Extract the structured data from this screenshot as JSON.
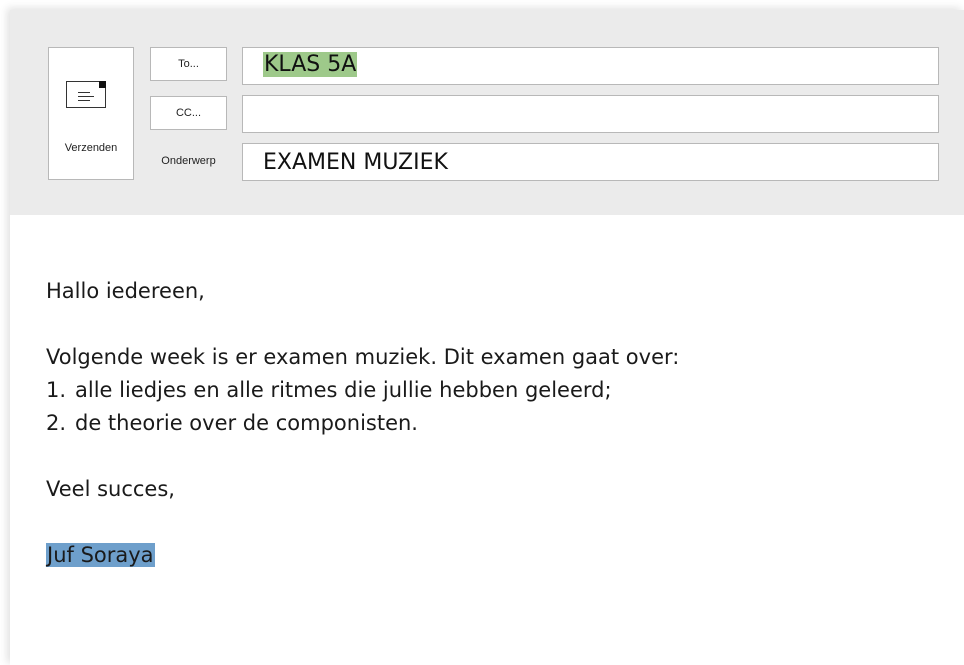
{
  "compose": {
    "send_label": "Verzenden",
    "to_button": "To...",
    "cc_button": "CC...",
    "subject_label": "Onderwerp",
    "to_value": "KLAS 5A",
    "cc_value": "",
    "subject_value": "EXAMEN MUZIEK",
    "highlight_colors": {
      "to_value": "#9ec98a",
      "signature": "#6e9fcb"
    }
  },
  "message": {
    "greeting": "Hallo iedereen,",
    "intro": "Volgende week is er examen muziek. Dit examen gaat over:",
    "list": [
      {
        "num": "1.",
        "text": "alle liedjes en alle ritmes die jullie hebben geleerd;"
      },
      {
        "num": "2.",
        "text": "de theorie over de componisten."
      }
    ],
    "closing": "Veel succes,",
    "signature": "Juf Soraya"
  }
}
